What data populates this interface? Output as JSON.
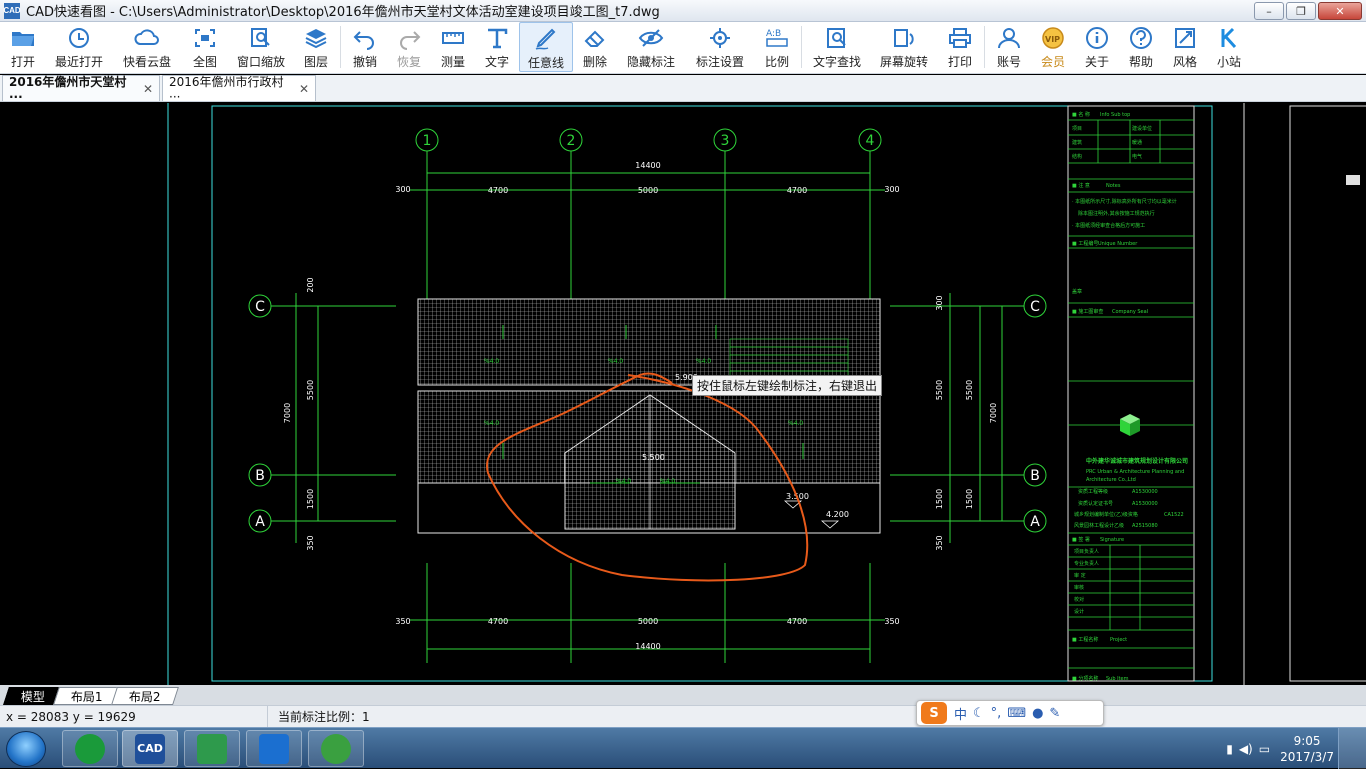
{
  "window": {
    "title": "CAD快速看图 - C:\\Users\\Administrator\\Desktop\\2016年儋州市天堂村文体活动室建设项目竣工图_t7.dwg",
    "app_icon_text": "CAD"
  },
  "toolbar": {
    "items": [
      {
        "label": "打开",
        "icon": "folder-open-icon"
      },
      {
        "label": "最近打开",
        "icon": "history-icon"
      },
      {
        "label": "快看云盘",
        "icon": "cloud-icon"
      },
      {
        "label": "全图",
        "icon": "fit-view-icon"
      },
      {
        "label": "窗口缩放",
        "icon": "zoom-window-icon"
      },
      {
        "label": "图层",
        "icon": "layers-icon"
      },
      {
        "label": "撤销",
        "icon": "undo-icon"
      },
      {
        "label": "恢复",
        "icon": "redo-icon"
      },
      {
        "label": "测量",
        "icon": "measure-icon"
      },
      {
        "label": "文字",
        "icon": "text-icon"
      },
      {
        "label": "任意线",
        "icon": "freehand-pen-icon"
      },
      {
        "label": "删除",
        "icon": "eraser-icon"
      },
      {
        "label": "隐藏标注",
        "icon": "eye-hide-icon"
      },
      {
        "label": "标注设置",
        "icon": "annotation-settings-icon"
      },
      {
        "label": "比例",
        "icon": "scale-icon"
      },
      {
        "label": "文字查找",
        "icon": "text-search-icon"
      },
      {
        "label": "屏幕旋转",
        "icon": "rotate-screen-icon"
      },
      {
        "label": "打印",
        "icon": "printer-icon"
      },
      {
        "label": "账号",
        "icon": "user-icon"
      },
      {
        "label": "会员",
        "icon": "vip-icon"
      },
      {
        "label": "关于",
        "icon": "info-icon"
      },
      {
        "label": "帮助",
        "icon": "help-icon"
      },
      {
        "label": "风格",
        "icon": "style-icon"
      },
      {
        "label": "小站",
        "icon": "station-icon"
      }
    ]
  },
  "tabs": [
    {
      "label": "2016年儋州市天堂村···",
      "active": true
    },
    {
      "label": "2016年儋州市行政村···",
      "active": false
    }
  ],
  "drawing": {
    "tooltip": "按住鼠标左键绘制标注，右键退出",
    "grid_labels": [
      "1",
      "2",
      "3",
      "4",
      "C",
      "B",
      "A"
    ],
    "dims_top": [
      "14400",
      "300",
      "4700",
      "5000",
      "4700",
      "300"
    ],
    "dims_bottom": [
      "350",
      "4700",
      "5000",
      "4700",
      "350",
      "14400"
    ],
    "dims_left": [
      "200",
      "5500",
      "7000",
      "1500",
      "350"
    ],
    "dims_right": [
      "300",
      "5500",
      "5500",
      "7000",
      "1500",
      "1500",
      "350"
    ],
    "elevations": [
      "5.900",
      "5.500",
      "3.500",
      "4.200"
    ],
    "company": "中外建华诚城市建筑规划设计有限公司"
  },
  "layout_tabs": [
    {
      "label": "模型",
      "active": true
    },
    {
      "label": "布局1",
      "active": false
    },
    {
      "label": "布局2",
      "active": false
    }
  ],
  "status": {
    "coords": "x = 28083  y = 19629",
    "scale": "当前标注比例：1"
  },
  "ime": {
    "logo": "S",
    "mode": "中"
  },
  "taskbar": {
    "items": [
      {
        "name": "cloud-app",
        "color": "#1a9a3a",
        "text": ""
      },
      {
        "name": "cad-app",
        "color": "#1f4f9a",
        "text": "CAD"
      },
      {
        "name": "network-app",
        "color": "#2e9a4c",
        "text": ""
      },
      {
        "name": "remote-app",
        "color": "#1b6fd0",
        "text": ""
      },
      {
        "name": "browser-app",
        "color": "#3aa040",
        "text": ""
      }
    ],
    "time": "9:05",
    "date": "2017/3/7"
  }
}
